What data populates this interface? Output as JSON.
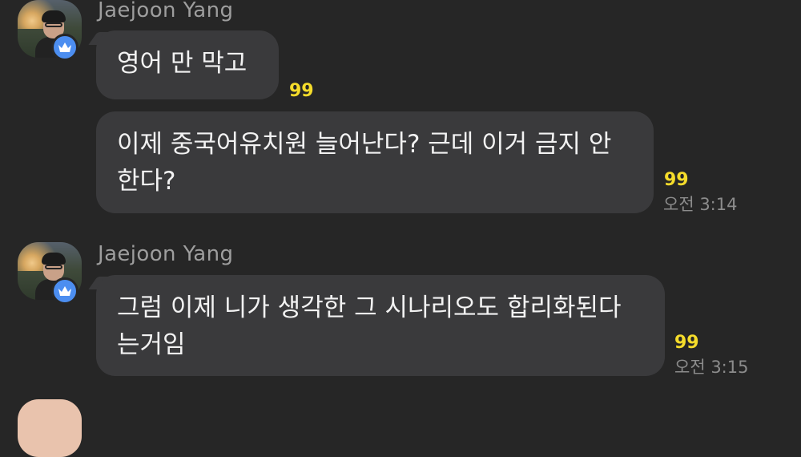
{
  "messages": [
    {
      "sender": "Jaejoon Yang",
      "badge_icon": "crown-icon",
      "bubbles": [
        {
          "text": "영어 만 막고",
          "unread": "99",
          "time": ""
        },
        {
          "text": "이제 중국어유치원 늘어난다? 근데 이거 금지 안 한다?",
          "unread": "99",
          "time": "오전 3:14"
        }
      ]
    },
    {
      "sender": "Jaejoon Yang",
      "badge_icon": "crown-icon",
      "bubbles": [
        {
          "text": "그럼 이제 니가 생각한 그 시나리오도 합리화된다 는거임",
          "unread": "99",
          "time": "오전 3:15"
        }
      ]
    }
  ],
  "colors": {
    "background": "#262626",
    "bubble": "#3a3a3c",
    "unread": "#f5dc2b",
    "badge": "#4c8ef0"
  }
}
